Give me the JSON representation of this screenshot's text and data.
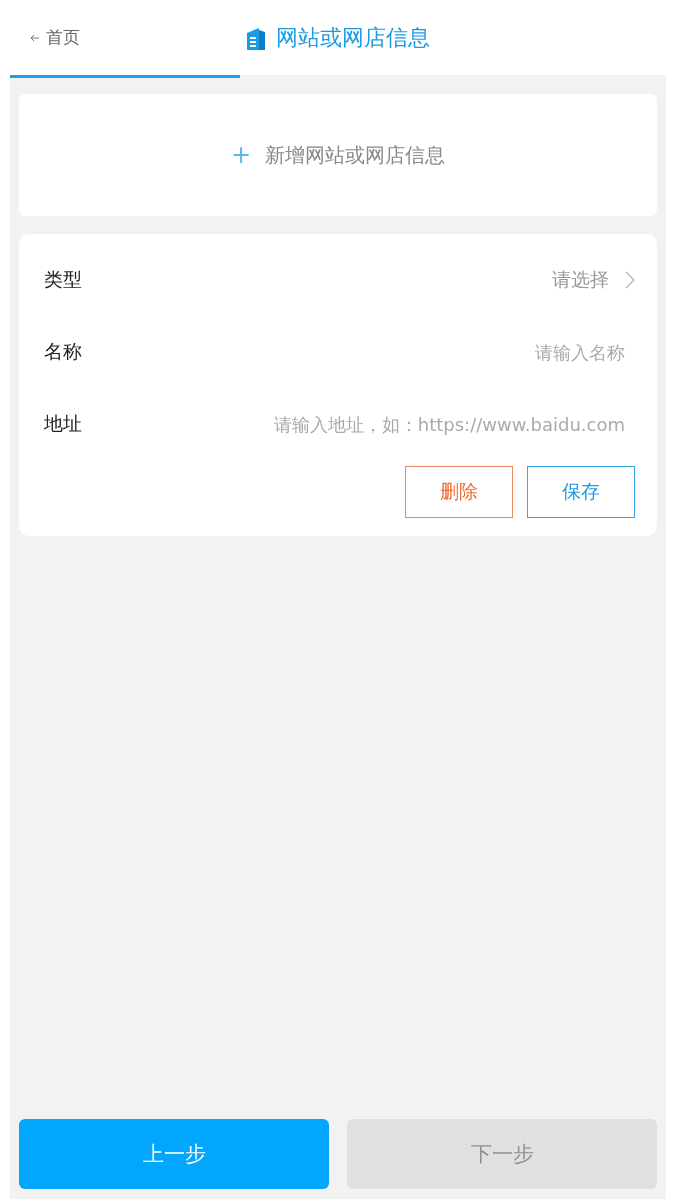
{
  "header": {
    "back_label": "首页",
    "title": "网站或网店信息"
  },
  "add_button": {
    "icon": "+",
    "label": "新增网站或网店信息"
  },
  "form": {
    "fields": [
      {
        "kind": "select",
        "label": "类型",
        "placeholder": "请选择"
      },
      {
        "kind": "input",
        "label": "名称",
        "placeholder": "请输入名称"
      },
      {
        "kind": "input",
        "label": "地址",
        "placeholder": "请输入地址，如：https://www.baidu.com"
      }
    ],
    "actions": [
      {
        "kind": "danger",
        "label": "删除"
      },
      {
        "kind": "primary",
        "label": "保存"
      }
    ]
  },
  "footer": [
    {
      "label": "上一步",
      "disabled": false
    },
    {
      "label": "下一步",
      "disabled": true
    }
  ]
}
